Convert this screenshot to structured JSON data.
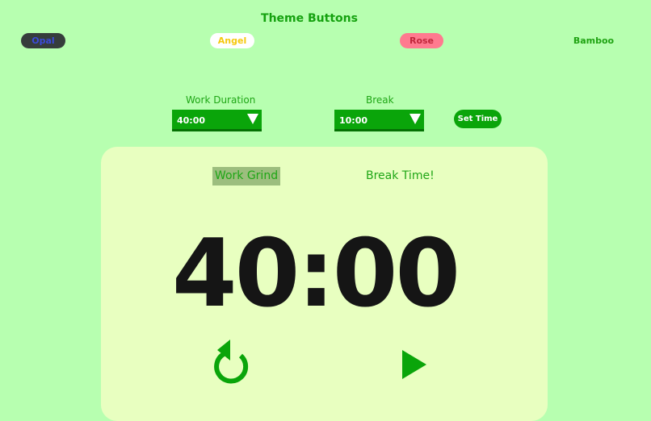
{
  "header": {
    "title": "Theme Buttons"
  },
  "themes": [
    {
      "label": "Opal"
    },
    {
      "label": "Angel"
    },
    {
      "label": "Rose"
    },
    {
      "label": "Bamboo"
    }
  ],
  "settings": {
    "work_label": "Work Duration",
    "work_value": "40:00",
    "break_label": "Break",
    "break_value": "10:00",
    "set_time_label": "Set Time"
  },
  "timer": {
    "tabs": [
      "Work Grind",
      "Break Time!"
    ],
    "active_tab": "Work Grind",
    "display": "40:00"
  },
  "icons": {
    "reset": "reset-icon",
    "play": "play-icon"
  },
  "colors": {
    "background": "#b7ffb0",
    "panel": "#e8ffc0",
    "accent": "#0aa50a",
    "active_tab": "#9cbe7e"
  }
}
